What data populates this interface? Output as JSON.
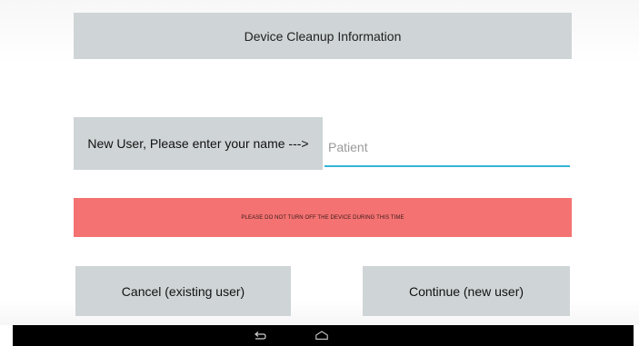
{
  "screen": {
    "title": "Device Cleanup Information",
    "name_prompt": "New User, Please enter your name --->",
    "name_input": {
      "value": "",
      "placeholder": "Patient"
    },
    "warning": "PLEASE DO NOT TURN OFF THE DEVICE DURING THIS TIME",
    "buttons": {
      "cancel_label": "Cancel (existing user)",
      "continue_label": "Continue (new user)"
    }
  },
  "navbar": {
    "icons": [
      "back-icon",
      "home-icon"
    ]
  },
  "colors": {
    "panel_gray": "#cfd4d6",
    "warning_red": "#f47272",
    "input_underline": "#35b3d6",
    "navbar": "#000000"
  }
}
